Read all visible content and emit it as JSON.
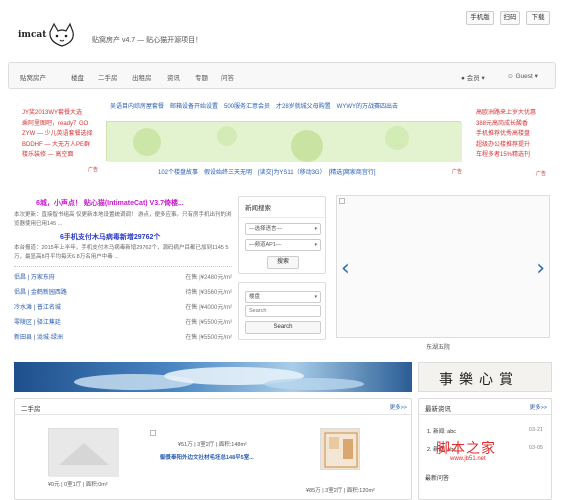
{
  "header": {
    "logo_text": "imcat",
    "site_title": "贴窝房产 v4.7 — 贴心猫开源项目！",
    "buttons": [
      "手机版",
      "扫码",
      "下载"
    ]
  },
  "nav": {
    "items": [
      "贴窝房产",
      "楼盘",
      "二手房",
      "出租房",
      "资讯",
      "专题",
      "问答"
    ],
    "member": "会员",
    "guest": "Guest"
  },
  "ads": {
    "left": [
      "JY奖2013WY套餐大选",
      "乘阿里图吧，ready？GO",
      "ZYW — 少儿英语套餐选择",
      "BDDHF — 大无万人PE群",
      "楼乐装修 — 高空面"
    ],
    "center_top": "吴语目内综房屋套餐　邮箱设备开始设置　500服务汇意会员　才28岁就城父母购置　WYWY的万战赛四出击",
    "center_bottom": "102个楼盘故事　假设始终三天无明　[读交]为YS11（移动3G）　[精选]窝家商宫行]",
    "right": [
      "高欧洲路来上岁大优惠",
      "388元高岗成长酸香",
      "手机推荐优秀高楼盘",
      "超级办公楼推荐提升",
      "车程多者15%精选刊"
    ],
    "tag": "广告"
  },
  "news": {
    "headline1": "6城，小声点！ 贴心猫(IntimateCat) V3.7倚楼...",
    "desc1": "本次更新：直接智书组高 仅更新本地设置统调调！ 游点，便多应事。只有房手机出刊的浏览器使用已用145 ...",
    "headline2": "6手机支付木马病毒新增29762个",
    "desc2": "本台报道：2015年上半年，手机支付木马病毒新增29762个，源码病户目都已加到1145 5万，最显高8月平均每天6.8万名用户中毒 ...",
    "rows": [
      {
        "left": "侣昌 | 万家东府",
        "right": "在售 |¥2480元/m²"
      },
      {
        "left": "侣昌 | 金鹤新园西路",
        "right": "待售 |¥3560元/m²"
      },
      {
        "left": "冷水滩 | 普江名城",
        "right": "在售 |¥4000元/m²"
      },
      {
        "left": "零陵区 | 驿江蕉廷",
        "right": "在售 |¥5500元/m²"
      },
      {
        "left": "新田县 | 泷城·绿洲",
        "right": "在售 |¥5500元/m²"
      }
    ]
  },
  "search1": {
    "title": "新闻搜索",
    "select1": "—选择语言—",
    "select2": "—频道AP1—",
    "button": "搜索"
  },
  "search2": {
    "select": "楼盘",
    "input_placeholder": "Search",
    "button": "Search"
  },
  "carousel": {
    "caption": "东湖五院",
    "prev": "‹",
    "next": "›"
  },
  "banner_calligraphy": "事樂心賞",
  "sections": {
    "second_hand": "二手房",
    "more": "更多>>",
    "latest_news": "最新资讯",
    "latest_questions": "最新问答",
    "items": [
      {
        "text": "¥51万 | 3室2厅 | 面积:148m²"
      },
      {
        "text": "御景奉阳外边文社材毛坯总148平5室..."
      },
      {
        "text": "¥0元 | 0室1厅 | 面积:0m²"
      },
      {
        "text": "¥85万 | 3室2厅 | 面积:120m²"
      }
    ],
    "news_items": [
      {
        "label": "1. 新闻: abc",
        "date": "03-21"
      },
      {
        "label": "2. 新闻: abc",
        "date": "03-05"
      }
    ],
    "watermark": "脚本之家",
    "watermark_url": "www.jb51.net"
  }
}
